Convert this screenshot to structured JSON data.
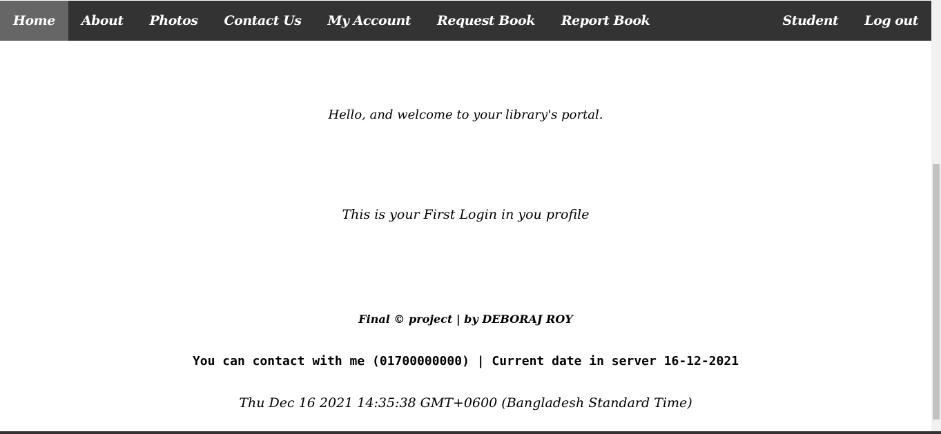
{
  "navbar": {
    "left_items": [
      {
        "label": "Home"
      },
      {
        "label": "About"
      },
      {
        "label": "Photos"
      },
      {
        "label": "Contact Us"
      },
      {
        "label": "My Account"
      },
      {
        "label": "Request Book"
      },
      {
        "label": "Report Book"
      }
    ],
    "right_items": [
      {
        "label": "Student"
      },
      {
        "label": "Log out"
      }
    ],
    "colors": {
      "background": "#333333",
      "active_background": "#666666",
      "text": "#ffffff"
    }
  },
  "main": {
    "welcome_text": "Hello, and welcome to your library's portal.",
    "first_login_text": "This is your First Login in you profile"
  },
  "footer": {
    "credit_text": "Final © project | by DEBORAJ ROY",
    "contact_text": "You can contact with me (01700000000) | Current date in server 16-12-2021",
    "client_datetime": "Thu Dec 16 2021 14:35:38 GMT+0600 (Bangladesh Standard Time)"
  }
}
